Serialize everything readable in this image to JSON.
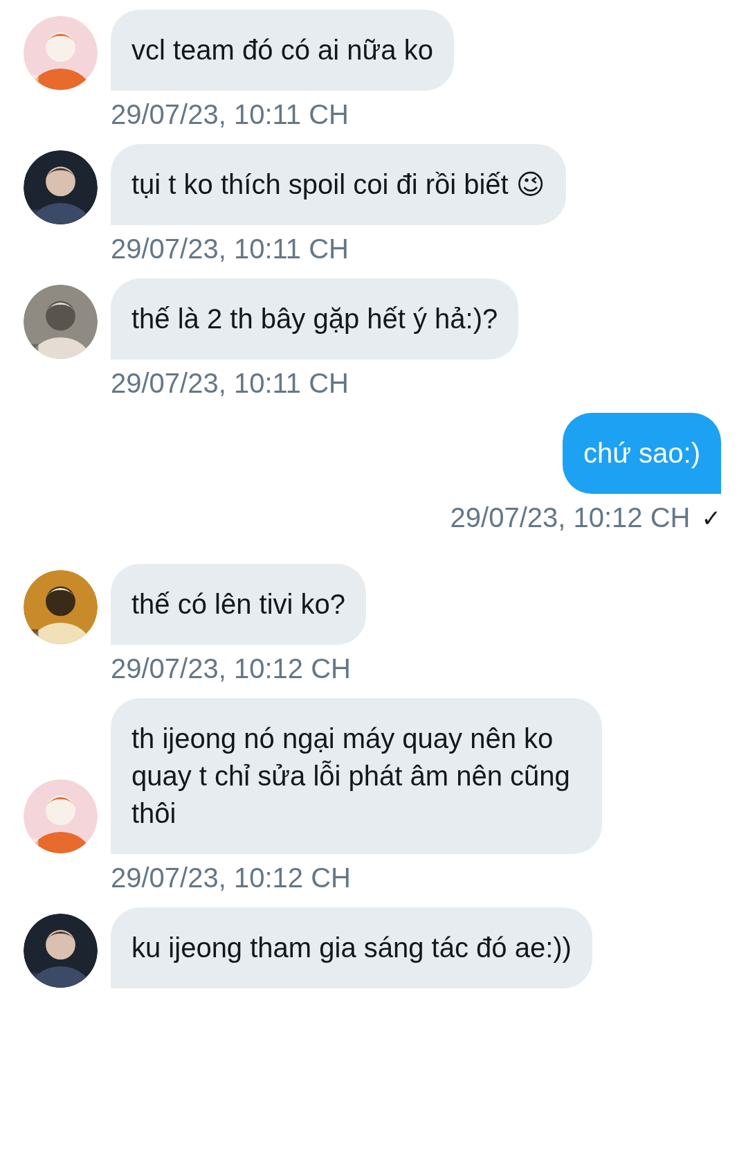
{
  "messages": [
    {
      "kind": "incoming",
      "text": "vcl team đó có ai nữa ko",
      "time": "29/07/23, 10:11 CH"
    },
    {
      "kind": "incoming",
      "text": "tụi t ko thích spoil coi đi rồi biết 😉",
      "time": "29/07/23, 10:11 CH"
    },
    {
      "kind": "incoming",
      "text": "thế là 2 th bây gặp hết ý hả:)?",
      "time": "29/07/23, 10:11 CH"
    },
    {
      "kind": "outgoing",
      "text": "chứ sao:)",
      "time": "29/07/23, 10:12 CH",
      "status": "✓"
    },
    {
      "kind": "incoming",
      "text": "thế có lên tivi ko?",
      "time": "29/07/23, 10:12 CH"
    },
    {
      "kind": "incoming",
      "text": "th ijeong nó ngại máy quay nên ko quay t chỉ sửa lỗi phát âm nên cũng thôi",
      "time": "29/07/23, 10:12 CH"
    },
    {
      "kind": "incoming",
      "text": "ku ijeong tham gia sáng tác đó ae:))"
    }
  ]
}
